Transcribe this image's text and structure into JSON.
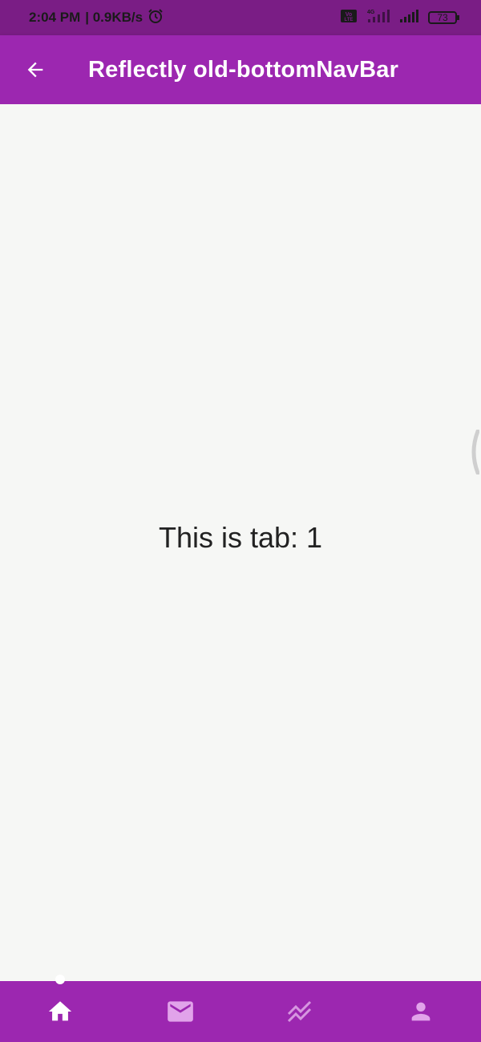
{
  "status_bar": {
    "time": "2:04 PM",
    "speed": "| 0.9KB/s",
    "network_badge": "Vo LTE",
    "network_type": "4G",
    "battery": "73",
    "icons": [
      "alarm-icon",
      "volte-icon",
      "signal-4g-icon",
      "signal-icon",
      "battery-icon"
    ]
  },
  "app_bar": {
    "title": "Reflectly old-bottomNavBar",
    "back_icon": "arrow-left-icon",
    "color": "#9c27b0"
  },
  "main": {
    "tab_text": "This is tab: 1"
  },
  "bottom_nav": {
    "color": "#9c27b0",
    "active_index": 0,
    "items": [
      {
        "icon": "home-icon",
        "active": true
      },
      {
        "icon": "mail-icon",
        "active": false
      },
      {
        "icon": "trending-icon",
        "active": false
      },
      {
        "icon": "person-icon",
        "active": false
      }
    ]
  }
}
